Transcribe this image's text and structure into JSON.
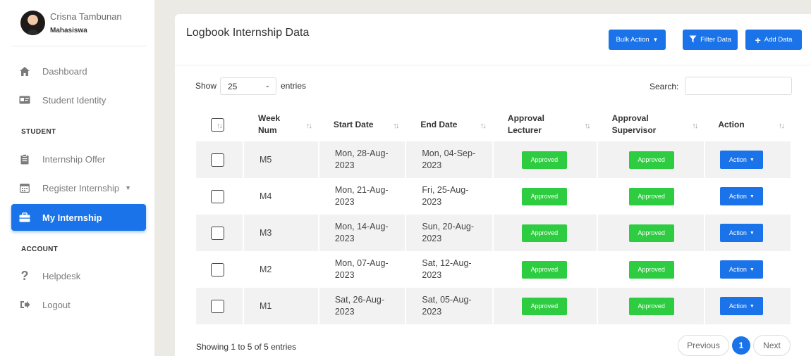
{
  "profile": {
    "name": "Crisna Tambunan",
    "role": "Mahasiswa"
  },
  "nav": {
    "dashboard": "Dashboard",
    "student_identity": "Student Identity",
    "section_student": "STUDENT",
    "internship_offer": "Internship Offer",
    "register_internship": "Register Internship",
    "my_internship": "My Internship",
    "section_account": "ACCOUNT",
    "helpdesk": "Helpdesk",
    "logout": "Logout"
  },
  "page": {
    "title": "Logbook Internship Data",
    "bulk_action": "Bulk Action",
    "filter_data": "Filter Data",
    "add_data": "Add Data",
    "show_label": "Show",
    "entries_value": "25",
    "entries_label": "entries",
    "search_label": "Search:",
    "search_value": ""
  },
  "table": {
    "headers": {
      "week_num": "Week Num",
      "start_date": "Start Date",
      "end_date": "End Date",
      "approval_lecturer": "Approval Lecturer",
      "approval_supervisor": "Approval Supervisor",
      "action": "Action"
    },
    "rows": [
      {
        "week": "M5",
        "start": "Mon, 28-Aug-2023",
        "end": "Mon, 04-Sep-2023",
        "lecturer": "Approved",
        "supervisor": "Approved",
        "action": "Action"
      },
      {
        "week": "M4",
        "start": "Mon, 21-Aug-2023",
        "end": "Fri, 25-Aug-2023",
        "lecturer": "Approved",
        "supervisor": "Approved",
        "action": "Action"
      },
      {
        "week": "M3",
        "start": "Mon, 14-Aug-2023",
        "end": "Sun, 20-Aug-2023",
        "lecturer": "Approved",
        "supervisor": "Approved",
        "action": "Action"
      },
      {
        "week": "M2",
        "start": "Mon, 07-Aug-2023",
        "end": "Sat, 12-Aug-2023",
        "lecturer": "Approved",
        "supervisor": "Approved",
        "action": "Action"
      },
      {
        "week": "M1",
        "start": "Sat, 26-Aug-2023",
        "end": "Sat, 05-Aug-2023",
        "lecturer": "Approved",
        "supervisor": "Approved",
        "action": "Action"
      }
    ]
  },
  "footer": {
    "showing": "Showing 1 to 5 of 5 entries",
    "previous": "Previous",
    "current_page": "1",
    "next": "Next"
  },
  "colors": {
    "accent": "#1a73e8",
    "approved": "#2ecc40"
  },
  "icons": {
    "dashboard": "home-icon",
    "student_identity": "id-card-icon",
    "internship_offer": "clipboard-icon",
    "register_internship": "calendar-icon",
    "my_internship": "briefcase-icon",
    "helpdesk": "question-icon",
    "logout": "logout-icon",
    "filter": "filter-icon",
    "add": "plus-icon"
  }
}
